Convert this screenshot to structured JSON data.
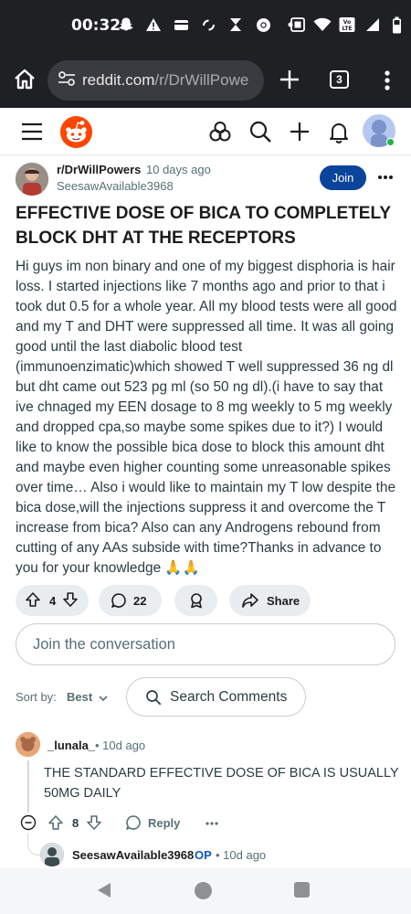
{
  "status_bar": {
    "time": "00:32",
    "icons": [
      "snapchat-icon",
      "warning-icon",
      "wallet-icon",
      "sync-icon",
      "hourglass-icon",
      "chrome-icon",
      "dot-icon",
      "screenshot-icon",
      "wifi-icon",
      "volte-icon",
      "signal-icon",
      "battery-icon"
    ],
    "volte_label": "Vo\nLTE"
  },
  "browser": {
    "url_host": "reddit.com",
    "url_path": "/r/DrWillPowe",
    "tab_count": "3"
  },
  "post": {
    "subreddit": "r/DrWillPowers",
    "age": "10 days ago",
    "author": "SeesawAvailable3968",
    "join_label": "Join",
    "title": "EFFECTIVE DOSE OF BICA TO COMPLETELY BLOCK DHT AT THE RECEPTORS",
    "body": "Hi guys im non binary and one of my biggest disphoria is hair loss. I started injections like 7 months ago and prior to that i took dut 0.5 for a whole year. All my blood tests were all good and my T and DHT were suppressed all time. It was all going good until the last diabolic blood test (immunoenzimatic)which showed T well suppressed 36 ng dl but dht came out 523 pg ml (so 50 ng dl).(i have to say that ive chnaged my EEN dosage to 8 mg weekly to 5 mg weekly and dropped cpa,so maybe some spikes due to it?) I would like to know the possible bica dose to block this amount dht and maybe even higher counting some unreasonable spikes over time… Also i would like to maintain my T low despite the bica dose,will the injections suppress it and overcome the T increase from bica? Also can any Androgens rebound from cutting of any AAs subside with time?Thanks in advance to you for your knowledge 🙏🙏",
    "score": "4",
    "comment_count": "22",
    "share_label": "Share"
  },
  "comments_section": {
    "join_placeholder": "Join the conversation",
    "sort_label": "Sort by:",
    "sort_value": "Best",
    "search_label": "Search Comments"
  },
  "comments": [
    {
      "user": "_lunala_",
      "age": "• 10d ago",
      "text": "THE STANDARD EFFECTIVE DOSE OF BICA IS USUALLY 50MG DAILY",
      "score": "8",
      "reply_label": "Reply"
    },
    {
      "user": "SeesawAvailable3968",
      "op_badge": "OP",
      "age": "• 10d ago"
    }
  ],
  "colors": {
    "reddit_orange": "#ff4500",
    "join_blue": "#0a449b",
    "op_blue": "#0a56c8",
    "online_green": "#1fb347"
  }
}
